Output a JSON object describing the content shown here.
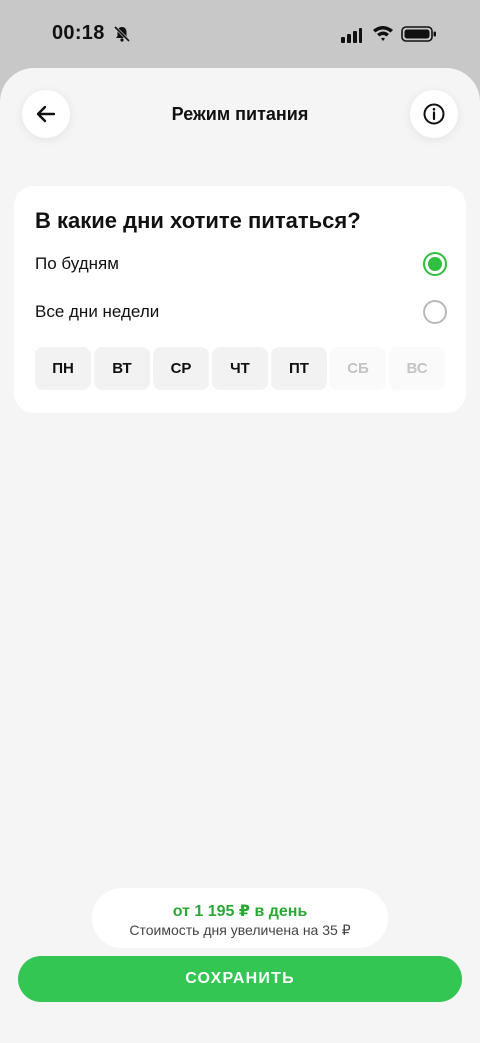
{
  "status_bar": {
    "time": "00:18",
    "icons": [
      "bell-muted-icon",
      "signal-icon",
      "wifi-icon",
      "battery-icon"
    ]
  },
  "header": {
    "title": "Режим питания",
    "back_icon": "arrow-left-icon",
    "info_icon": "info-icon"
  },
  "card": {
    "question": "В какие дни хотите питаться?",
    "options": [
      {
        "label": "По будням",
        "selected": true
      },
      {
        "label": "Все дни недели",
        "selected": false
      }
    ],
    "days": [
      {
        "label": "ПН",
        "enabled": true
      },
      {
        "label": "ВТ",
        "enabled": true
      },
      {
        "label": "СР",
        "enabled": true
      },
      {
        "label": "ЧТ",
        "enabled": true
      },
      {
        "label": "ПТ",
        "enabled": true
      },
      {
        "label": "СБ",
        "enabled": false
      },
      {
        "label": "ВС",
        "enabled": false
      }
    ]
  },
  "price": {
    "main": "от 1 195 ₽ в день",
    "sub": "Стоимость дня увеличена на 35 ₽"
  },
  "save_button": {
    "label": "СОХРАНИТЬ"
  },
  "colors": {
    "accent": "#2fbe3f",
    "button": "#33c653",
    "price_text": "#2aa836",
    "background": "#f5f5f5"
  }
}
